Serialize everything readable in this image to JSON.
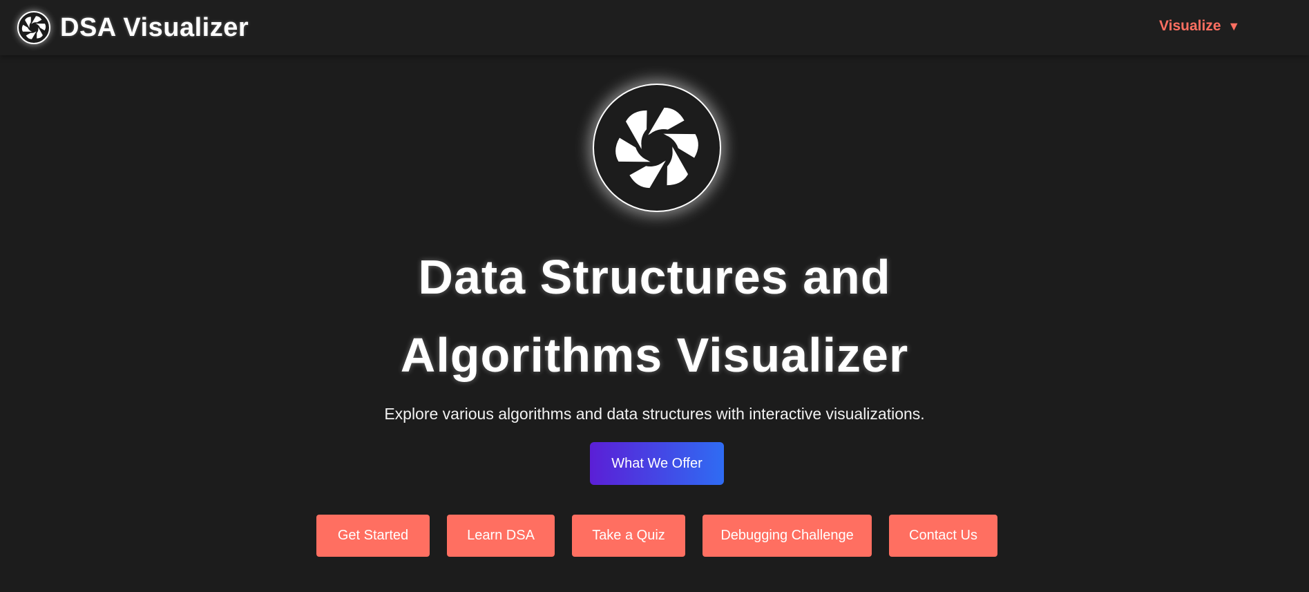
{
  "navbar": {
    "brand_title": "DSA Visualizer",
    "logo_icon": "aperture-icon",
    "menu": {
      "label": "Visualize",
      "caret": "▼",
      "color": "#ff6f61"
    }
  },
  "hero": {
    "logo_icon": "aperture-icon",
    "title_line1": "Data Structures and",
    "title_line2": "Algorithms Visualizer",
    "subtitle": "Explore various algorithms and data structures with interactive visualizations.",
    "offer_button": "What We Offer"
  },
  "actions": {
    "get_started": "Get Started",
    "learn_dsa": "Learn DSA",
    "take_quiz": "Take a Quiz",
    "debugging_challenge": "Debugging Challenge",
    "contact_us": "Contact Us",
    "accent_color": "#ff6f61"
  },
  "colors": {
    "background": "#1c1c1c",
    "gradient_start": "#5b1fd6",
    "gradient_end": "#2f6cf3"
  }
}
